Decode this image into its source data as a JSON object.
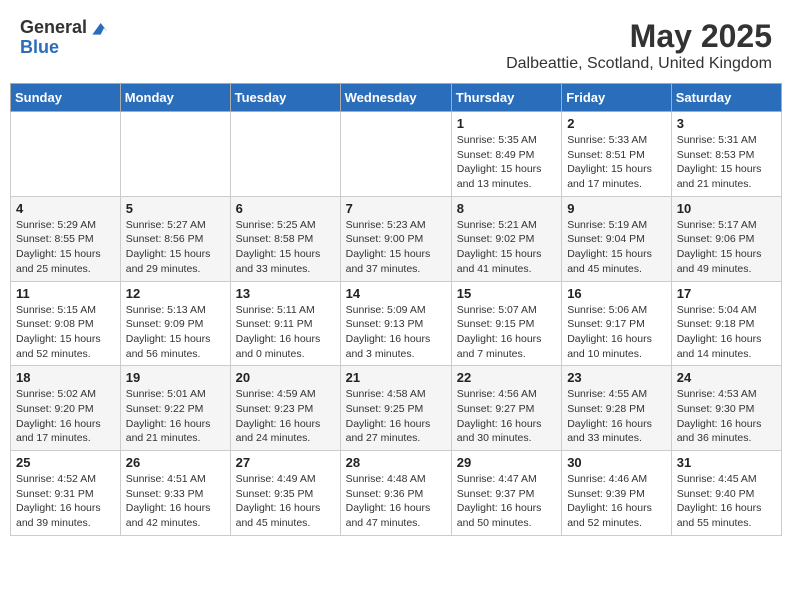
{
  "header": {
    "logo_line1": "General",
    "logo_line2": "Blue",
    "month_title": "May 2025",
    "location": "Dalbeattie, Scotland, United Kingdom"
  },
  "weekdays": [
    "Sunday",
    "Monday",
    "Tuesday",
    "Wednesday",
    "Thursday",
    "Friday",
    "Saturday"
  ],
  "weeks": [
    [
      {
        "day": "",
        "info": ""
      },
      {
        "day": "",
        "info": ""
      },
      {
        "day": "",
        "info": ""
      },
      {
        "day": "",
        "info": ""
      },
      {
        "day": "1",
        "info": "Sunrise: 5:35 AM\nSunset: 8:49 PM\nDaylight: 15 hours\nand 13 minutes."
      },
      {
        "day": "2",
        "info": "Sunrise: 5:33 AM\nSunset: 8:51 PM\nDaylight: 15 hours\nand 17 minutes."
      },
      {
        "day": "3",
        "info": "Sunrise: 5:31 AM\nSunset: 8:53 PM\nDaylight: 15 hours\nand 21 minutes."
      }
    ],
    [
      {
        "day": "4",
        "info": "Sunrise: 5:29 AM\nSunset: 8:55 PM\nDaylight: 15 hours\nand 25 minutes."
      },
      {
        "day": "5",
        "info": "Sunrise: 5:27 AM\nSunset: 8:56 PM\nDaylight: 15 hours\nand 29 minutes."
      },
      {
        "day": "6",
        "info": "Sunrise: 5:25 AM\nSunset: 8:58 PM\nDaylight: 15 hours\nand 33 minutes."
      },
      {
        "day": "7",
        "info": "Sunrise: 5:23 AM\nSunset: 9:00 PM\nDaylight: 15 hours\nand 37 minutes."
      },
      {
        "day": "8",
        "info": "Sunrise: 5:21 AM\nSunset: 9:02 PM\nDaylight: 15 hours\nand 41 minutes."
      },
      {
        "day": "9",
        "info": "Sunrise: 5:19 AM\nSunset: 9:04 PM\nDaylight: 15 hours\nand 45 minutes."
      },
      {
        "day": "10",
        "info": "Sunrise: 5:17 AM\nSunset: 9:06 PM\nDaylight: 15 hours\nand 49 minutes."
      }
    ],
    [
      {
        "day": "11",
        "info": "Sunrise: 5:15 AM\nSunset: 9:08 PM\nDaylight: 15 hours\nand 52 minutes."
      },
      {
        "day": "12",
        "info": "Sunrise: 5:13 AM\nSunset: 9:09 PM\nDaylight: 15 hours\nand 56 minutes."
      },
      {
        "day": "13",
        "info": "Sunrise: 5:11 AM\nSunset: 9:11 PM\nDaylight: 16 hours\nand 0 minutes."
      },
      {
        "day": "14",
        "info": "Sunrise: 5:09 AM\nSunset: 9:13 PM\nDaylight: 16 hours\nand 3 minutes."
      },
      {
        "day": "15",
        "info": "Sunrise: 5:07 AM\nSunset: 9:15 PM\nDaylight: 16 hours\nand 7 minutes."
      },
      {
        "day": "16",
        "info": "Sunrise: 5:06 AM\nSunset: 9:17 PM\nDaylight: 16 hours\nand 10 minutes."
      },
      {
        "day": "17",
        "info": "Sunrise: 5:04 AM\nSunset: 9:18 PM\nDaylight: 16 hours\nand 14 minutes."
      }
    ],
    [
      {
        "day": "18",
        "info": "Sunrise: 5:02 AM\nSunset: 9:20 PM\nDaylight: 16 hours\nand 17 minutes."
      },
      {
        "day": "19",
        "info": "Sunrise: 5:01 AM\nSunset: 9:22 PM\nDaylight: 16 hours\nand 21 minutes."
      },
      {
        "day": "20",
        "info": "Sunrise: 4:59 AM\nSunset: 9:23 PM\nDaylight: 16 hours\nand 24 minutes."
      },
      {
        "day": "21",
        "info": "Sunrise: 4:58 AM\nSunset: 9:25 PM\nDaylight: 16 hours\nand 27 minutes."
      },
      {
        "day": "22",
        "info": "Sunrise: 4:56 AM\nSunset: 9:27 PM\nDaylight: 16 hours\nand 30 minutes."
      },
      {
        "day": "23",
        "info": "Sunrise: 4:55 AM\nSunset: 9:28 PM\nDaylight: 16 hours\nand 33 minutes."
      },
      {
        "day": "24",
        "info": "Sunrise: 4:53 AM\nSunset: 9:30 PM\nDaylight: 16 hours\nand 36 minutes."
      }
    ],
    [
      {
        "day": "25",
        "info": "Sunrise: 4:52 AM\nSunset: 9:31 PM\nDaylight: 16 hours\nand 39 minutes."
      },
      {
        "day": "26",
        "info": "Sunrise: 4:51 AM\nSunset: 9:33 PM\nDaylight: 16 hours\nand 42 minutes."
      },
      {
        "day": "27",
        "info": "Sunrise: 4:49 AM\nSunset: 9:35 PM\nDaylight: 16 hours\nand 45 minutes."
      },
      {
        "day": "28",
        "info": "Sunrise: 4:48 AM\nSunset: 9:36 PM\nDaylight: 16 hours\nand 47 minutes."
      },
      {
        "day": "29",
        "info": "Sunrise: 4:47 AM\nSunset: 9:37 PM\nDaylight: 16 hours\nand 50 minutes."
      },
      {
        "day": "30",
        "info": "Sunrise: 4:46 AM\nSunset: 9:39 PM\nDaylight: 16 hours\nand 52 minutes."
      },
      {
        "day": "31",
        "info": "Sunrise: 4:45 AM\nSunset: 9:40 PM\nDaylight: 16 hours\nand 55 minutes."
      }
    ]
  ]
}
